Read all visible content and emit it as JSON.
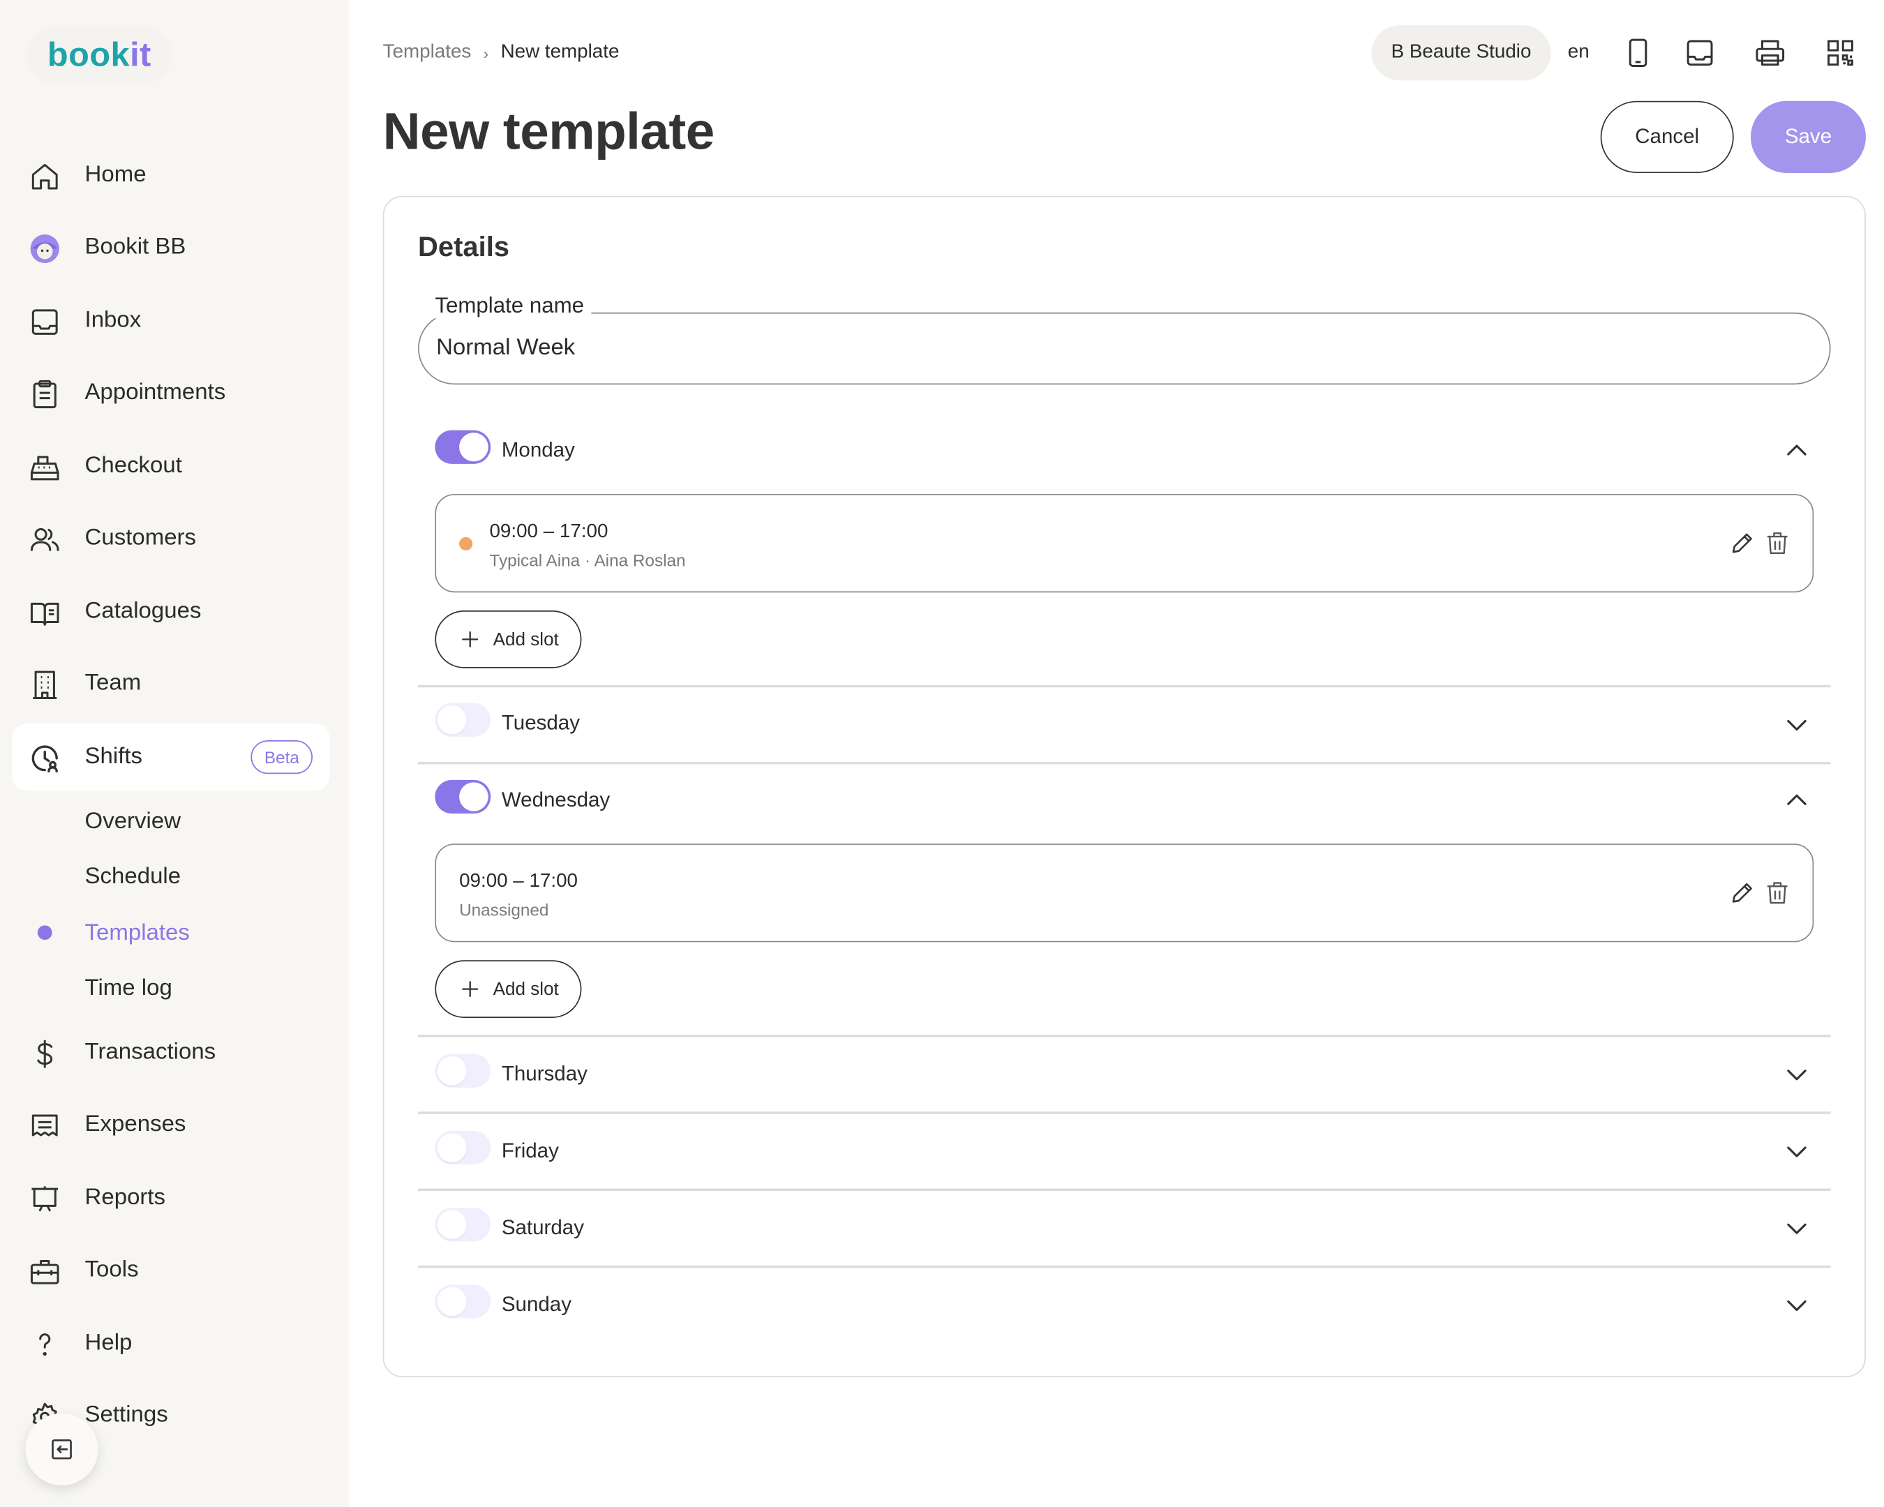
{
  "logo": {
    "part1": "book",
    "part2": "it"
  },
  "sidebar": {
    "items": [
      {
        "label": "Home"
      },
      {
        "label": "Bookit BB"
      },
      {
        "label": "Inbox"
      },
      {
        "label": "Appointments"
      },
      {
        "label": "Checkout"
      },
      {
        "label": "Customers"
      },
      {
        "label": "Catalogues"
      },
      {
        "label": "Team"
      },
      {
        "label": "Shifts",
        "badge": "Beta"
      },
      {
        "label": "Transactions"
      },
      {
        "label": "Expenses"
      },
      {
        "label": "Reports"
      },
      {
        "label": "Tools"
      },
      {
        "label": "Help"
      },
      {
        "label": "Settings"
      }
    ],
    "shifts_sub": [
      {
        "label": "Overview"
      },
      {
        "label": "Schedule"
      },
      {
        "label": "Templates"
      },
      {
        "label": "Time log"
      }
    ]
  },
  "header": {
    "breadcrumb": {
      "parent": "Templates",
      "separator": "›",
      "current": "New template"
    },
    "studio": "B Beaute Studio",
    "lang": "en"
  },
  "page": {
    "title": "New template",
    "cancel_label": "Cancel",
    "save_label": "Save"
  },
  "details": {
    "title": "Details",
    "template_name_label": "Template name",
    "template_name_value": "Normal Week"
  },
  "days": [
    {
      "name": "Monday",
      "enabled": true,
      "expanded": true
    },
    {
      "name": "Tuesday",
      "enabled": false,
      "expanded": false
    },
    {
      "name": "Wednesday",
      "enabled": true,
      "expanded": true
    },
    {
      "name": "Thursday",
      "enabled": false,
      "expanded": false
    },
    {
      "name": "Friday",
      "enabled": false,
      "expanded": false
    },
    {
      "name": "Saturday",
      "enabled": false,
      "expanded": false
    },
    {
      "name": "Sunday",
      "enabled": false,
      "expanded": false
    }
  ],
  "slots": {
    "monday": {
      "time": "09:00 – 17:00",
      "subtitle": "Typical Aina · Aina Roslan"
    },
    "wednesday": {
      "time": "09:00 – 17:00",
      "subtitle": "Unassigned"
    }
  },
  "add_slot_label": "Add slot",
  "colors": {
    "accent": "#8a76e6",
    "save": "#a394ec",
    "teal": "#1fa3a8",
    "slot_dot": "#f1a560"
  }
}
